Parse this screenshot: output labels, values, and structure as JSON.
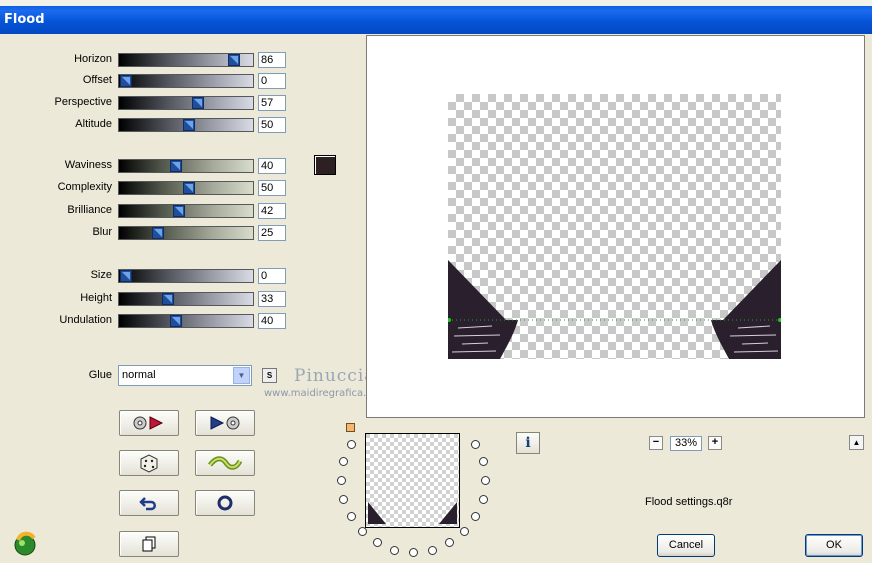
{
  "window": {
    "title": "Flood"
  },
  "sliders_group1": [
    {
      "label": "Horizon",
      "value": "86",
      "fraction": 0.86,
      "style": "blue"
    },
    {
      "label": "Offset",
      "value": "0",
      "fraction": 0.0,
      "style": "blue"
    },
    {
      "label": "Perspective",
      "value": "57",
      "fraction": 0.57,
      "style": "blue"
    },
    {
      "label": "Altitude",
      "value": "50",
      "fraction": 0.5,
      "style": "blue"
    }
  ],
  "sliders_group2": [
    {
      "label": "Waviness",
      "value": "40",
      "fraction": 0.4,
      "style": "olive"
    },
    {
      "label": "Complexity",
      "value": "50",
      "fraction": 0.5,
      "style": "olive"
    },
    {
      "label": "Brilliance",
      "value": "42",
      "fraction": 0.42,
      "style": "olive"
    },
    {
      "label": "Blur",
      "value": "25",
      "fraction": 0.25,
      "style": "olive"
    }
  ],
  "sliders_group3": [
    {
      "label": "Size",
      "value": "0",
      "fraction": 0.0,
      "style": "blue"
    },
    {
      "label": "Height",
      "value": "33",
      "fraction": 0.33,
      "style": "blue"
    },
    {
      "label": "Undulation",
      "value": "40",
      "fraction": 0.4,
      "style": "blue"
    }
  ],
  "color_swatch": "#2d2023",
  "glue": {
    "label": "Glue",
    "value": "normal"
  },
  "watermark": {
    "name": "Pinuccia",
    "url": "www.maidiregrafica.eu"
  },
  "zoom": {
    "value": "33%"
  },
  "settings_file": "Flood settings.q8r",
  "buttons": {
    "cancel": "Cancel",
    "ok": "OK",
    "info": "i",
    "s": "S"
  },
  "colors": {
    "titlebar": "#0654d8",
    "water": "#2a1f2c"
  }
}
